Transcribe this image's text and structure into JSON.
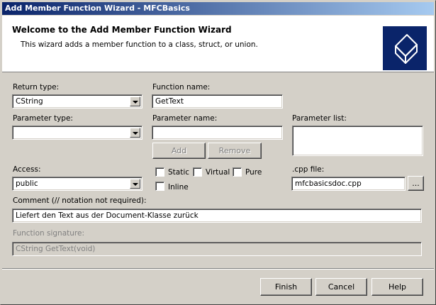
{
  "window": {
    "title": "Add Member Function Wizard - MFCBasics"
  },
  "banner": {
    "heading": "Welcome to the Add Member Function Wizard",
    "description": "This wizard adds a member function to a class, struct, or union."
  },
  "form": {
    "return_type": {
      "label": "Return type:",
      "value": "CString"
    },
    "function_name": {
      "label": "Function name:",
      "value": "GetText"
    },
    "parameter_type": {
      "label": "Parameter type:",
      "value": ""
    },
    "parameter_name": {
      "label": "Parameter name:",
      "value": ""
    },
    "parameter_list": {
      "label": "Parameter list:"
    },
    "add_label": "Add",
    "remove_label": "Remove",
    "access": {
      "label": "Access:",
      "value": "public"
    },
    "static_label": "Static",
    "virtual_label": "Virtual",
    "pure_label": "Pure",
    "inline_label": "Inline",
    "cpp_file": {
      "label": ".cpp file:",
      "value": "mfcbasicsdoc.cpp",
      "browse_label": "..."
    },
    "comment": {
      "label": "Comment (// notation not required):",
      "value": "Liefert den Text aus der Document-Klasse zurück"
    },
    "signature": {
      "label": "Function signature:",
      "value": "CString GetText(void)"
    }
  },
  "buttons": {
    "finish": "Finish",
    "cancel": "Cancel",
    "help": "Help"
  },
  "colors": {
    "titlebar_start": "#0a246a",
    "titlebar_end": "#a6caf0",
    "face": "#d4d0c8",
    "logo": "#0a246a"
  }
}
